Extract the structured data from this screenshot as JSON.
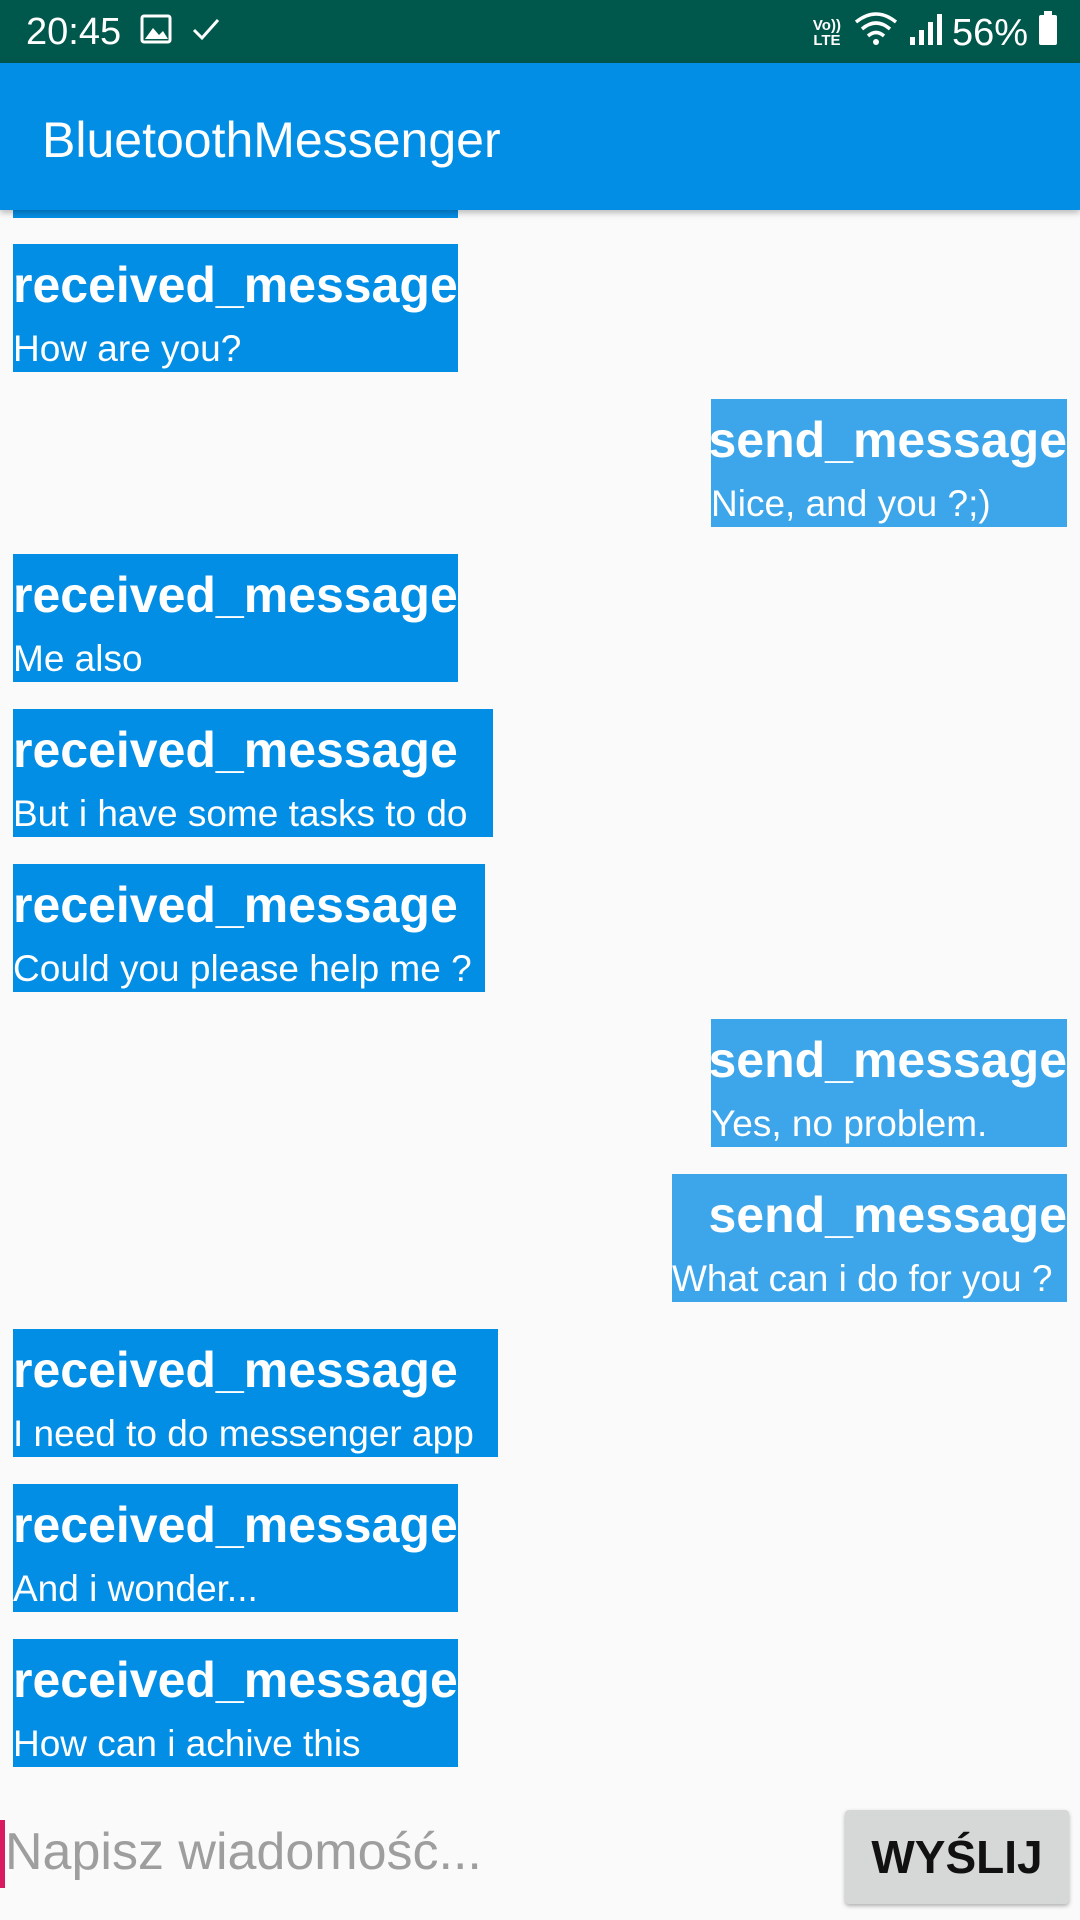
{
  "status_bar": {
    "time": "20:45",
    "left_icons": [
      "image-icon",
      "check-icon"
    ],
    "network_label": "Vo)) LTE",
    "battery": "56%",
    "background_color": "#00574b"
  },
  "app_bar": {
    "title": "BluetoothMessenger",
    "color": "#038ee5"
  },
  "messages": [
    {
      "direction": "received",
      "title": "received_message",
      "text": "How are you?"
    },
    {
      "direction": "sent",
      "title": "send_message",
      "text": "Nice, and you ?;)"
    },
    {
      "direction": "received",
      "title": "received_message",
      "text": "Me also"
    },
    {
      "direction": "received",
      "title": "received_message",
      "text": "But i have some tasks to do"
    },
    {
      "direction": "received",
      "title": "received_message",
      "text": "Could you please help me ?"
    },
    {
      "direction": "sent",
      "title": "send_message",
      "text": "Yes, no problem."
    },
    {
      "direction": "sent",
      "title": "send_message",
      "text": "What can i do for you ?"
    },
    {
      "direction": "received",
      "title": "received_message",
      "text": "I need to do messenger app"
    },
    {
      "direction": "received",
      "title": "received_message",
      "text": "And i wonder..."
    },
    {
      "direction": "received",
      "title": "received_message",
      "text": "How can i achive this"
    }
  ],
  "composer": {
    "placeholder": "Napisz wiadomość...",
    "value": "",
    "send_label": "WYŚLIJ"
  },
  "colors": {
    "received_bubble": "#038ee5",
    "sent_bubble": "#3da6ea",
    "cursor": "#d81b60"
  }
}
